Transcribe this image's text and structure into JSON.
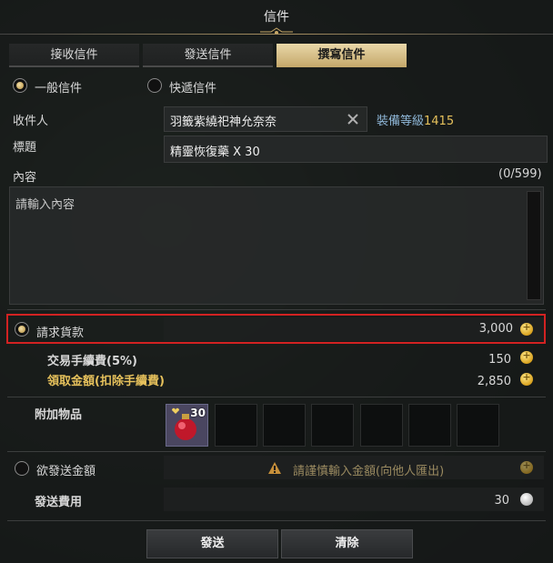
{
  "window": {
    "title": "信件"
  },
  "tabs": [
    {
      "label": "接收信件",
      "active": false
    },
    {
      "label": "發送信件",
      "active": false
    },
    {
      "label": "撰寫信件",
      "active": true
    }
  ],
  "mail_type": {
    "options": [
      "一般信件",
      "快遞信件"
    ],
    "selected": "一般信件"
  },
  "recipient": {
    "label": "收件人",
    "value": "羽籤紫繞祀神允奈奈",
    "gear_label": "裝備等級",
    "gear_level": "1415"
  },
  "subject": {
    "label": "標題",
    "value": "精靈恢復藥 X 30"
  },
  "content": {
    "label": "內容",
    "counter": "(0/599)",
    "placeholder": "請輸入內容"
  },
  "payment_request": {
    "label": "請求貨款",
    "amount": "3,000",
    "selected": true
  },
  "fee": {
    "label": "交易手續費(5%)",
    "amount": "150"
  },
  "receive": {
    "label": "領取金額(扣除手續費)",
    "amount": "2,850"
  },
  "attachments": {
    "label": "附加物品",
    "item": {
      "icon": "heart-potion-icon",
      "count": "30"
    }
  },
  "send_gold": {
    "label": "欲發送金額",
    "warning": "請謹慎輸入金額(向他人匯出)"
  },
  "shipping": {
    "label": "發送費用",
    "amount": "30"
  },
  "buttons": {
    "send": "發送",
    "clear": "清除"
  },
  "colors": {
    "gold_text": "#e6c15c",
    "level_blue": "#8fb7d8",
    "highlight_red": "#d22222"
  }
}
